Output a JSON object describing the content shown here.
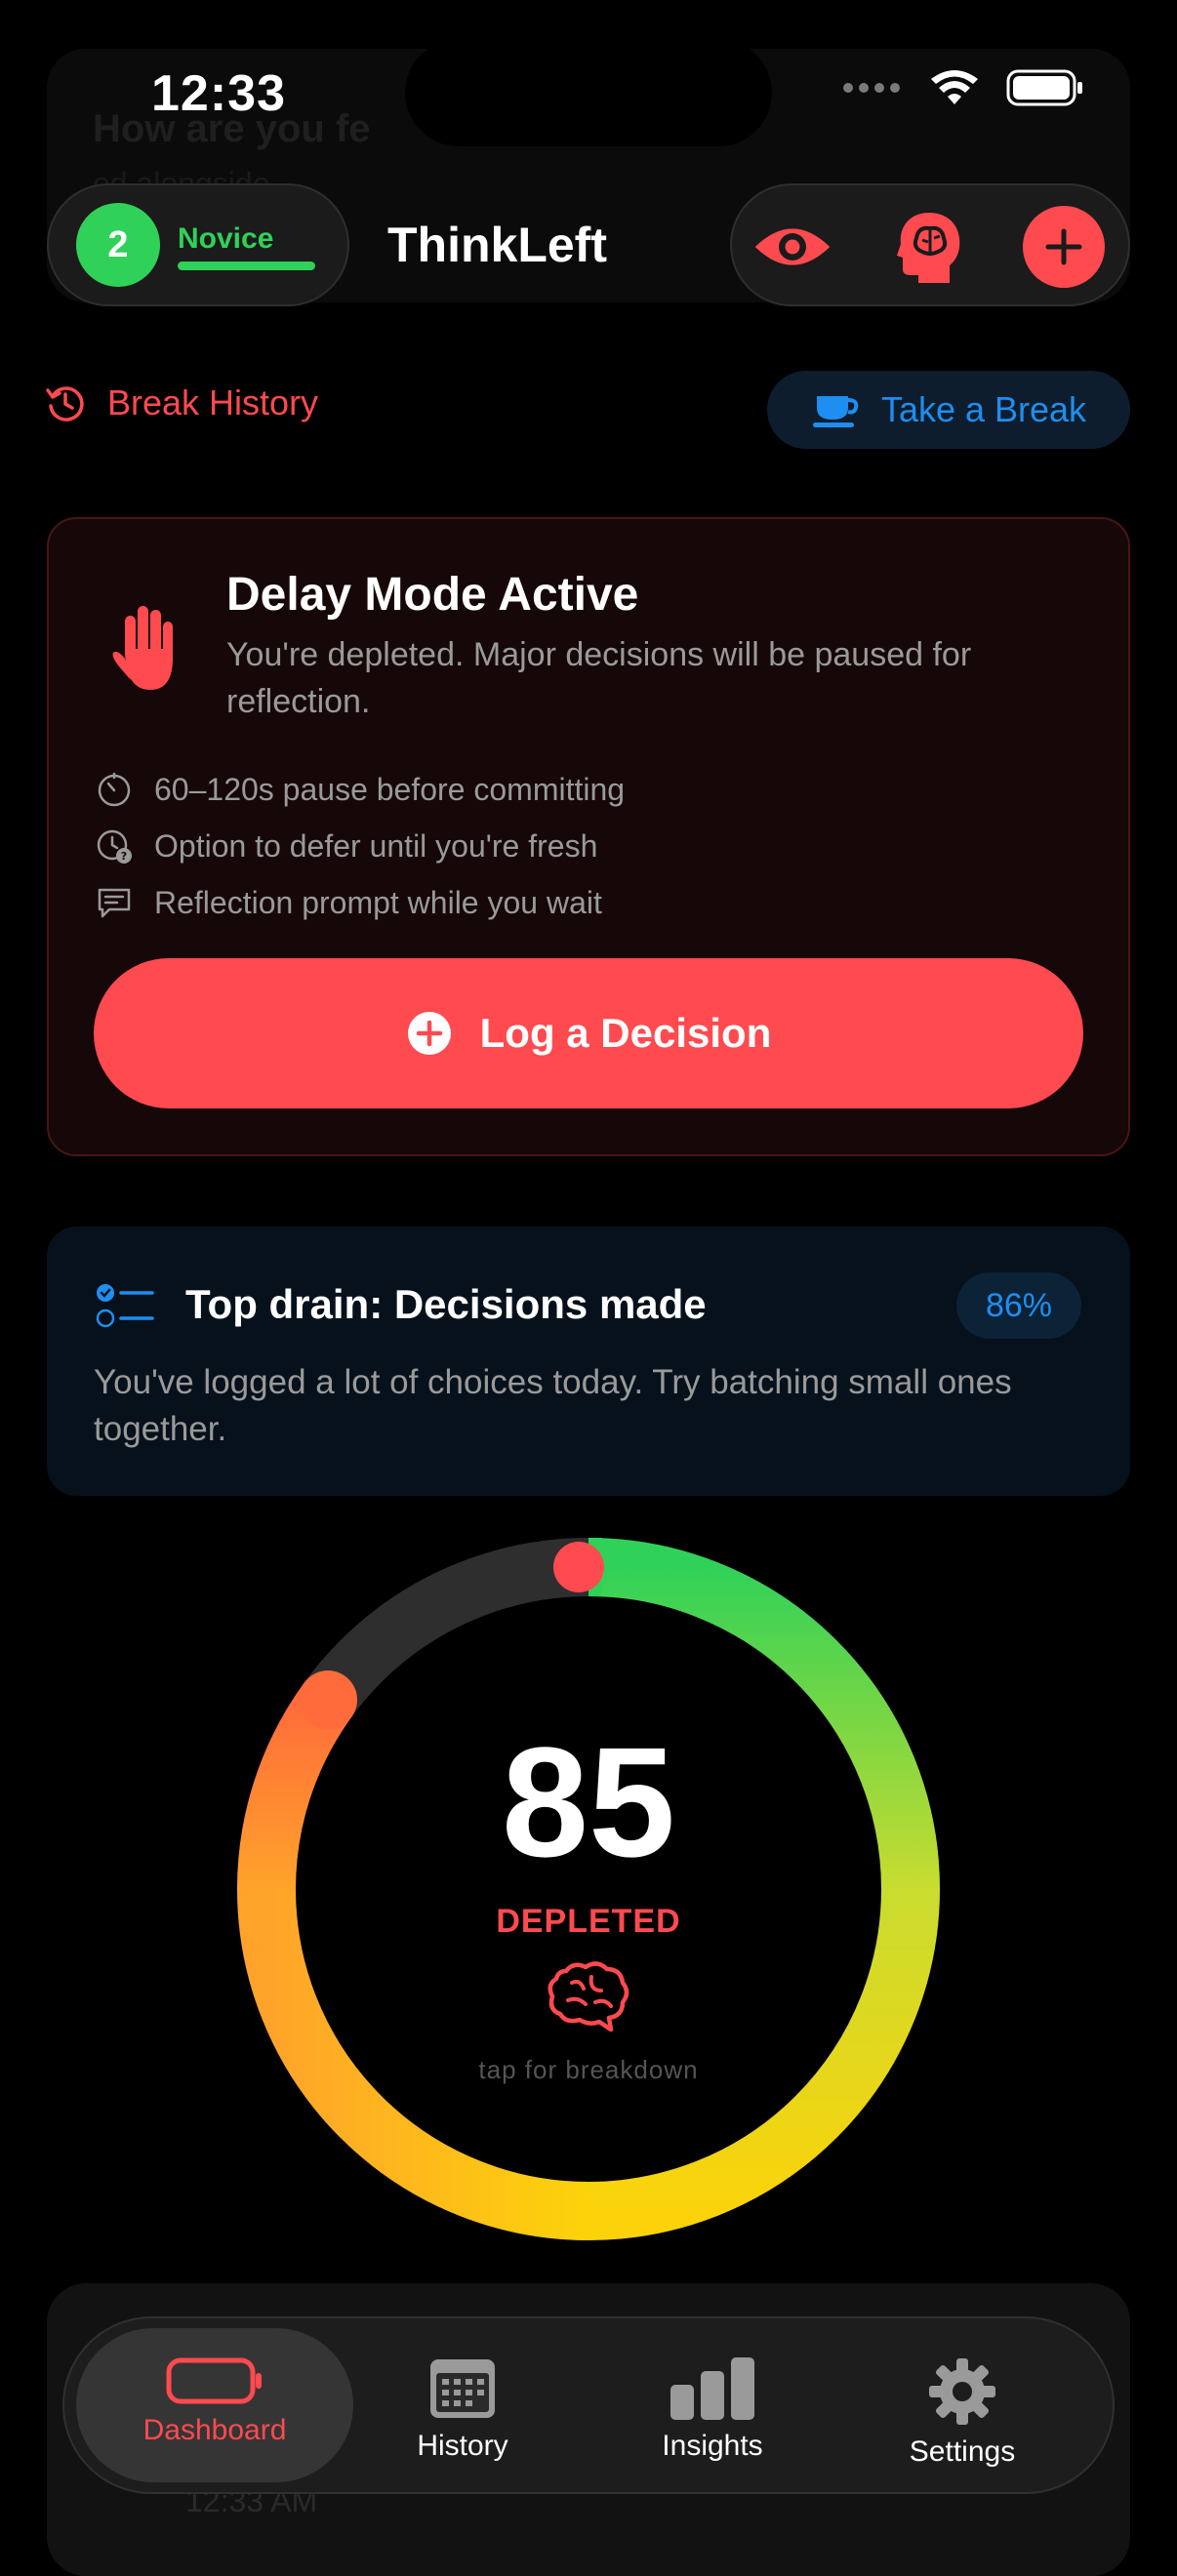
{
  "status": {
    "time": "12:33"
  },
  "ghost": {
    "header_text": "How are you fe",
    "sub_text": "ed alongside",
    "bottom_time": "12:33 AM"
  },
  "header": {
    "level_number": "2",
    "level_name": "Novice",
    "level_progress": 0.95,
    "title": "ThinkLeft",
    "actions": [
      "eye-icon",
      "brain-head-icon",
      "plus-icon"
    ]
  },
  "break_row": {
    "history_label": "Break History",
    "take_break_label": "Take a Break"
  },
  "delay_card": {
    "title": "Delay Mode Active",
    "description": "You're depleted. Major decisions will be paused for reflection.",
    "items": [
      {
        "icon": "timer-icon",
        "label": "60–120s pause before committing"
      },
      {
        "icon": "clock-question-icon",
        "label": "Option to defer until you're fresh"
      },
      {
        "icon": "message-icon",
        "label": "Reflection prompt while you wait"
      }
    ],
    "button_label": "Log a Decision"
  },
  "drain_card": {
    "title": "Top drain: Decisions made",
    "badge": "86%",
    "description": "You've logged a lot of choices today. Try batching small ones together."
  },
  "gauge": {
    "value": "85",
    "percent": 85,
    "status": "DEPLETED",
    "hint": "tap for breakdown"
  },
  "tabs": [
    {
      "label": "Dashboard",
      "icon": "battery-icon",
      "active": true
    },
    {
      "label": "History",
      "icon": "calendar-icon",
      "active": false
    },
    {
      "label": "Insights",
      "icon": "bar-chart-icon",
      "active": false
    },
    {
      "label": "Settings",
      "icon": "gear-icon",
      "active": false
    }
  ],
  "colors": {
    "accent_red": "#ff4a4f",
    "accent_green": "#30d158",
    "accent_blue": "#1e8ef0",
    "background": "#000000"
  }
}
